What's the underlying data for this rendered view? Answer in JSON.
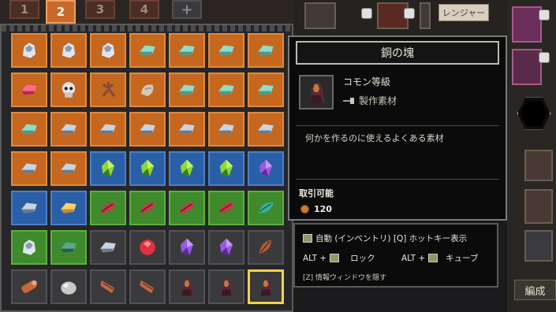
{
  "tabs": [
    {
      "label": "1",
      "active": false
    },
    {
      "label": "2",
      "active": true
    },
    {
      "label": "3",
      "active": false
    },
    {
      "label": "4",
      "active": false
    },
    {
      "label": "+",
      "active": false
    }
  ],
  "tooltip": {
    "title": "銅の塊",
    "rarity": "コモン等級",
    "category": "製作素材",
    "description": "何かを作るのに使えるよくある素材",
    "tradable": "取引可能",
    "price": "120"
  },
  "hotkeys": {
    "row1": "自動 (インベントリ) [Q] ホットキー表示",
    "row2a_key": "ALT +",
    "row2a_action": "ロック",
    "row2b_key": "ALT +",
    "row2b_action": "キューブ",
    "row3": "[Z] 情報ウィンドウを隠す"
  },
  "side": {
    "class_label": "レンジャー",
    "formation_button": "編成"
  },
  "inventory": {
    "rows": [
      [
        "orange:ore-white",
        "orange:ore-white",
        "orange:ore-white",
        "orange:ingot-teal",
        "orange:ingot-teal",
        "orange:ingot-teal",
        "orange:ingot-teal"
      ],
      [
        "orange:ingot-red",
        "orange:skull",
        "orange:root",
        "orange:shell",
        "orange:ingot-teal",
        "orange:ingot-teal",
        "orange:ingot-teal"
      ],
      [
        "orange:ingot-teal",
        "orange:ingot-silver",
        "orange:ingot-silver",
        "orange:ingot-silver",
        "orange:ingot-silver",
        "orange:ingot-silver",
        "orange:ingot-silver"
      ],
      [
        "orange:ingot-silver",
        "orange:ingot-silver",
        "blue:gem-green",
        "blue:gem-green",
        "blue:gem-green",
        "blue:gem-green",
        "blue:gem-purple"
      ],
      [
        "blue:ingot-silver",
        "blue:ingot-gold",
        "green:leaf-red",
        "green:leaf-red",
        "green:leaf-red",
        "green:leaf-red",
        "green:leaf-teal"
      ],
      [
        "green:ore-white",
        "green:ingot-darkteal",
        "dark:ingot-silver",
        "dark:gem-red",
        "dark:gem-purple",
        "dark:gem-purple",
        "dark:leaf-brown"
      ],
      [
        "dark:log",
        "dark:rock",
        "dark:wood",
        "dark:wood",
        "dark:copper",
        "dark:copper",
        "sel:copper"
      ]
    ]
  },
  "colors": {
    "rare_orange": "#c5671f",
    "uncommon_green": "#3f8a2c",
    "magic_blue": "#2a5fa8",
    "selected": "#f4d24a"
  }
}
